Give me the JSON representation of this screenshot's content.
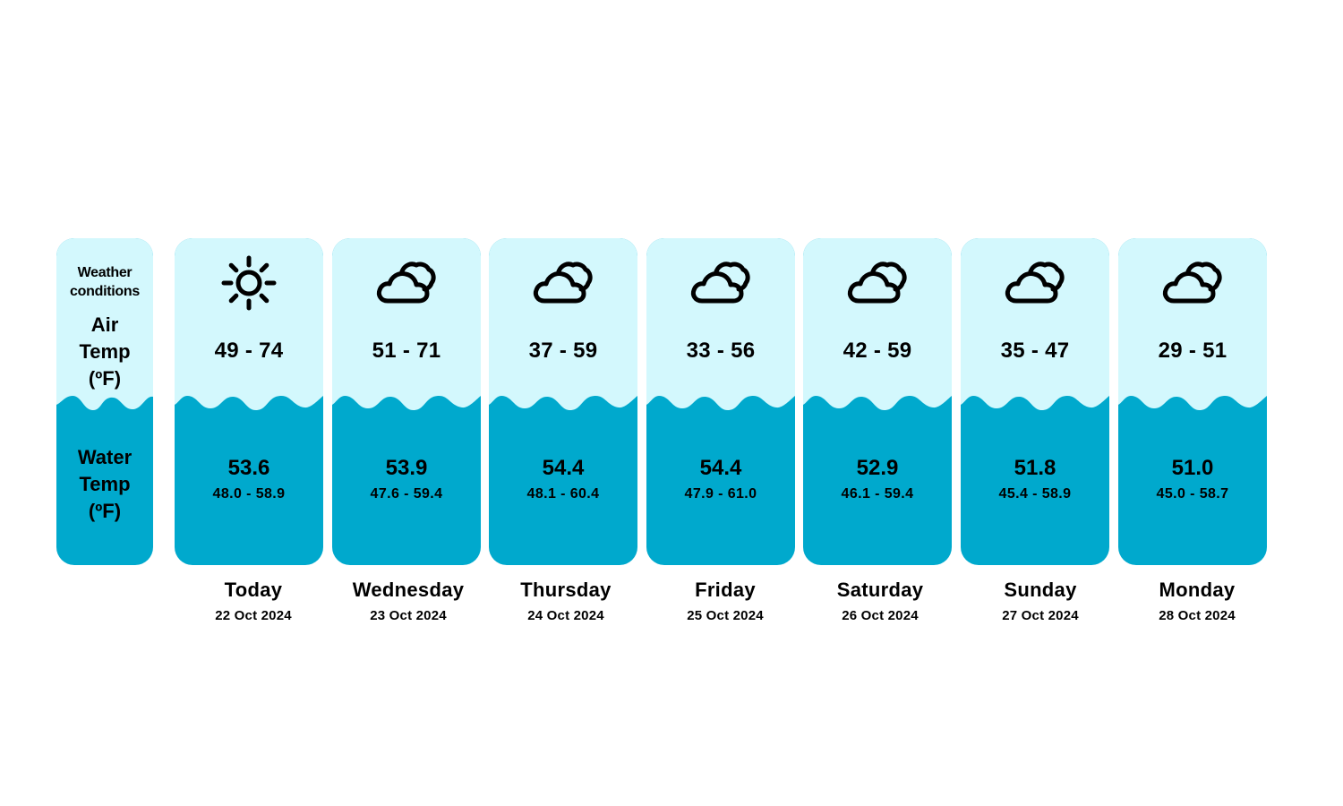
{
  "legend": {
    "weather_line1": "Weather",
    "weather_line2": "conditions",
    "air_line1": "Air",
    "air_line2": "Temp",
    "air_line3": "(ºF)",
    "water_line1": "Water",
    "water_line2": "Temp",
    "water_line3": "(ºF)"
  },
  "colors": {
    "air_bg": "#d3f8fd",
    "water_bg": "#00a9cd",
    "icon": "#000000"
  },
  "days": [
    {
      "name": "Today",
      "date": "22 Oct 2024",
      "icon": "sun-icon",
      "air": "49 - 74",
      "water_avg": "53.6",
      "water_range": "48.0 - 58.9"
    },
    {
      "name": "Wednesday",
      "date": "23 Oct 2024",
      "icon": "cloud-icon",
      "air": "51 - 71",
      "water_avg": "53.9",
      "water_range": "47.6 - 59.4"
    },
    {
      "name": "Thursday",
      "date": "24 Oct 2024",
      "icon": "cloud-icon",
      "air": "37 - 59",
      "water_avg": "54.4",
      "water_range": "48.1 - 60.4"
    },
    {
      "name": "Friday",
      "date": "25 Oct 2024",
      "icon": "cloud-icon",
      "air": "33 - 56",
      "water_avg": "54.4",
      "water_range": "47.9 - 61.0"
    },
    {
      "name": "Saturday",
      "date": "26 Oct 2024",
      "icon": "cloud-icon",
      "air": "42 - 59",
      "water_avg": "52.9",
      "water_range": "46.1 - 59.4"
    },
    {
      "name": "Sunday",
      "date": "27 Oct 2024",
      "icon": "cloud-icon",
      "air": "35 - 47",
      "water_avg": "51.8",
      "water_range": "45.4 - 58.9"
    },
    {
      "name": "Monday",
      "date": "28 Oct 2024",
      "icon": "cloud-icon",
      "air": "29 - 51",
      "water_avg": "51.0",
      "water_range": "45.0 - 58.7"
    }
  ]
}
